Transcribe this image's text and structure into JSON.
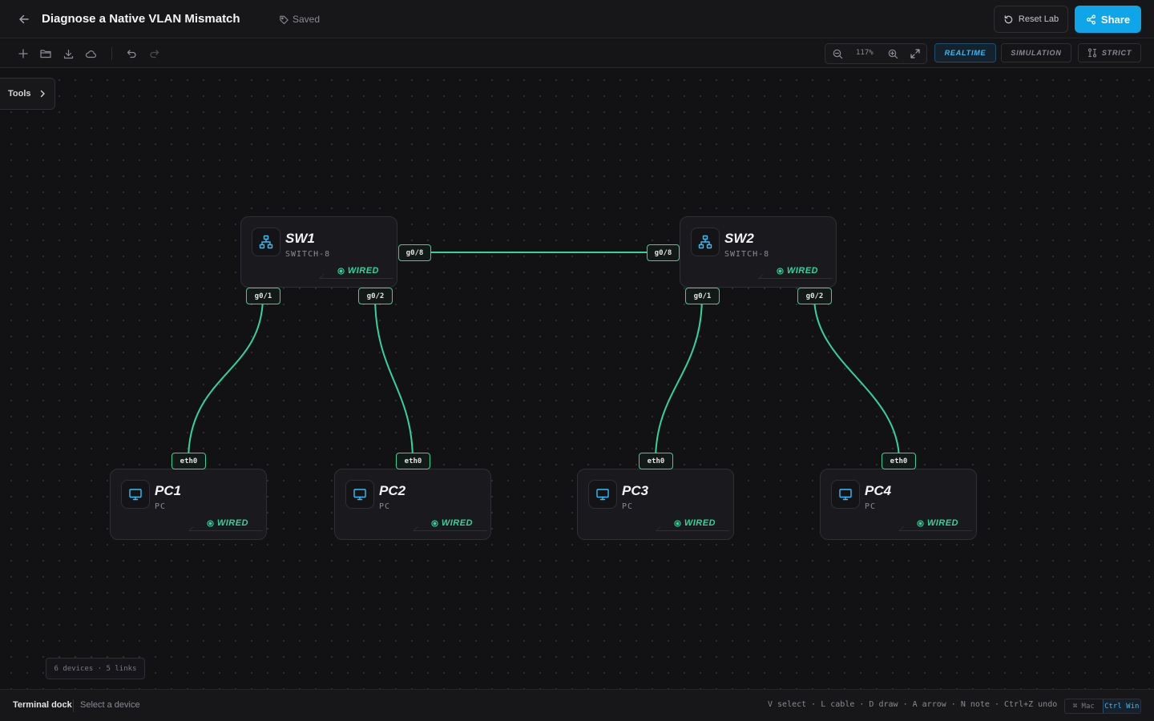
{
  "header": {
    "title": "Diagnose a Native VLAN Mismatch",
    "save_status": "Saved",
    "reset_label": "Reset Lab",
    "share_label": "Share"
  },
  "toolbar": {
    "zoom_level": "117%",
    "modes": [
      "REALTIME",
      "SIMULATION",
      "STRICT"
    ],
    "active_mode": "REALTIME"
  },
  "canvas": {
    "tools_label": "Tools",
    "devices": [
      {
        "name": "SW1",
        "type": "SWITCH-8",
        "status": "WIRED",
        "icon": "network-switch-icon"
      },
      {
        "name": "SW2",
        "type": "SWITCH-8",
        "status": "WIRED",
        "icon": "network-switch-icon"
      },
      {
        "name": "PC1",
        "type": "PC",
        "status": "WIRED",
        "icon": "monitor-icon"
      },
      {
        "name": "PC2",
        "type": "PC",
        "status": "WIRED",
        "icon": "monitor-icon"
      },
      {
        "name": "PC3",
        "type": "PC",
        "status": "WIRED",
        "icon": "monitor-icon"
      },
      {
        "name": "PC4",
        "type": "PC",
        "status": "WIRED",
        "icon": "monitor-icon"
      }
    ],
    "ports": {
      "sw1_uplink": "g0/8",
      "sw2_uplink": "g0/8",
      "sw1_p1": "g0/1",
      "sw1_p2": "g0/2",
      "sw2_p1": "g0/1",
      "sw2_p2": "g0/2",
      "pc1": "eth0",
      "pc2": "eth0",
      "pc3": "eth0",
      "pc4": "eth0"
    },
    "stats": "6 devices · 5 links"
  },
  "footer": {
    "dock_label": "Terminal dock",
    "dock_hint": "Select a device",
    "shortcuts": "V select · L cable · D draw · A arrow · N note · Ctrl+Z undo",
    "os_options": [
      "⌘ Mac",
      "Ctrl Win"
    ],
    "active_os": "Ctrl Win"
  },
  "colors": {
    "accent": "#0ea5e9",
    "link": "#34d399",
    "icon": "#38bdf8"
  }
}
